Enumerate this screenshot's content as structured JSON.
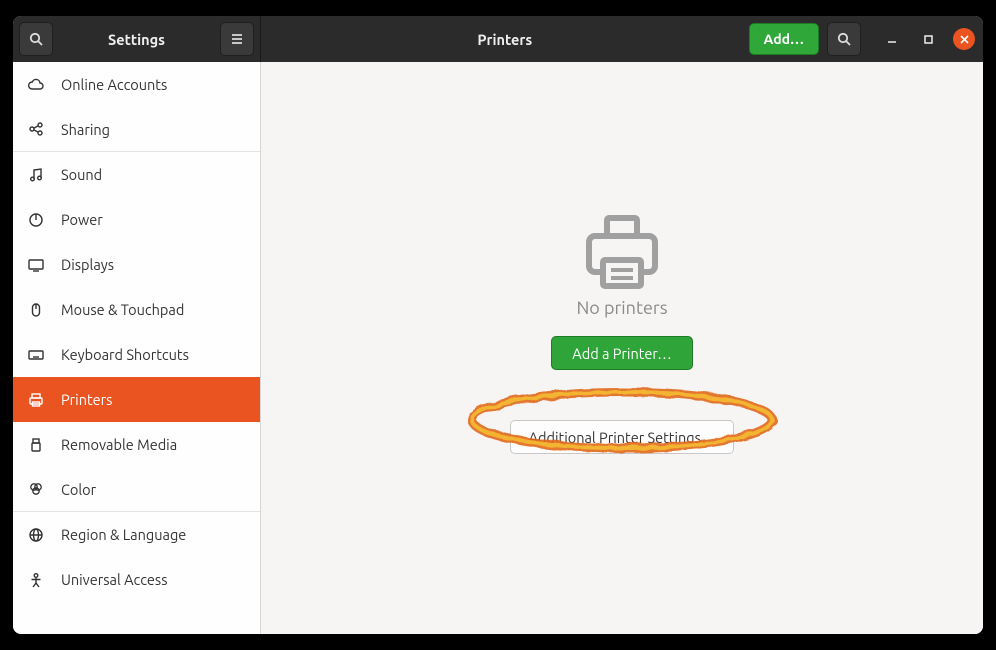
{
  "titlebar": {
    "settings_title": "Settings",
    "page_title": "Printers",
    "add_button": "Add…"
  },
  "sidebar": {
    "items": [
      {
        "id": "online-accounts",
        "label": "Online Accounts",
        "icon": "cloud",
        "active": false,
        "sep": false
      },
      {
        "id": "sharing",
        "label": "Sharing",
        "icon": "share",
        "active": false,
        "sep": true
      },
      {
        "id": "sound",
        "label": "Sound",
        "icon": "music",
        "active": false,
        "sep": false
      },
      {
        "id": "power",
        "label": "Power",
        "icon": "power",
        "active": false,
        "sep": false
      },
      {
        "id": "displays",
        "label": "Displays",
        "icon": "display",
        "active": false,
        "sep": false
      },
      {
        "id": "mouse-touchpad",
        "label": "Mouse & Touchpad",
        "icon": "mouse",
        "active": false,
        "sep": false
      },
      {
        "id": "keyboard",
        "label": "Keyboard Shortcuts",
        "icon": "keyboard",
        "active": false,
        "sep": false
      },
      {
        "id": "printers",
        "label": "Printers",
        "icon": "printer",
        "active": true,
        "sep": false
      },
      {
        "id": "removable-media",
        "label": "Removable Media",
        "icon": "usb",
        "active": false,
        "sep": false
      },
      {
        "id": "color",
        "label": "Color",
        "icon": "color",
        "active": false,
        "sep": true
      },
      {
        "id": "region-language",
        "label": "Region & Language",
        "icon": "globe",
        "active": false,
        "sep": false
      },
      {
        "id": "universal-access",
        "label": "Universal Access",
        "icon": "person",
        "active": false,
        "sep": false
      }
    ]
  },
  "main": {
    "empty_label": "No printers",
    "add_button": "Add a Printer…",
    "additional_button": "Additional Printer Settings…"
  },
  "annotation": {
    "highlight_target": "add-printer-button",
    "style": "hand-drawn-ellipse",
    "colors": [
      "#e26b1a",
      "#f0b020",
      "#ffdd30"
    ]
  },
  "colors": {
    "accent": "#e95420",
    "green": "#2fa839",
    "headerbar": "#2b2b2b"
  }
}
